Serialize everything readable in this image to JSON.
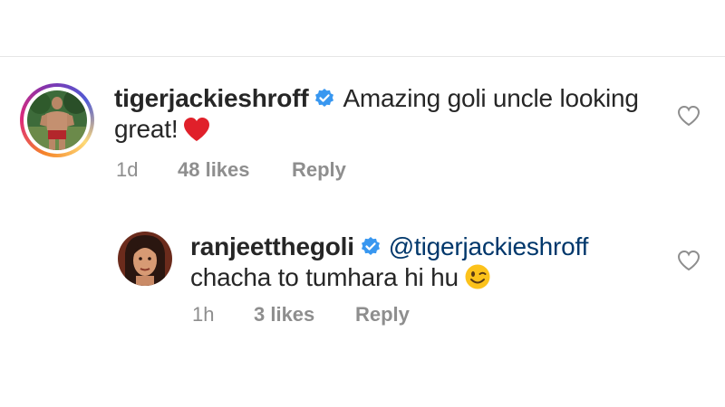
{
  "comments": [
    {
      "username": "tigerjackieshroff",
      "text_line1": "Amazing goli uncle looking",
      "text_line2": "great!",
      "text_emoji": "red-heart",
      "time": "1d",
      "likes": "48 likes",
      "reply": "Reply"
    },
    {
      "username": "ranjeetthegoli",
      "mention": "@tigerjackieshroff",
      "text_line2": "chacha to tumhara hi hu",
      "text_emoji": "winking-face",
      "time": "1h",
      "likes": "3 likes",
      "reply": "Reply"
    }
  ],
  "colors": {
    "verified": "#3897f0",
    "heart": "#ed4956",
    "mention": "#00376b",
    "meta": "#8e8e8e"
  }
}
